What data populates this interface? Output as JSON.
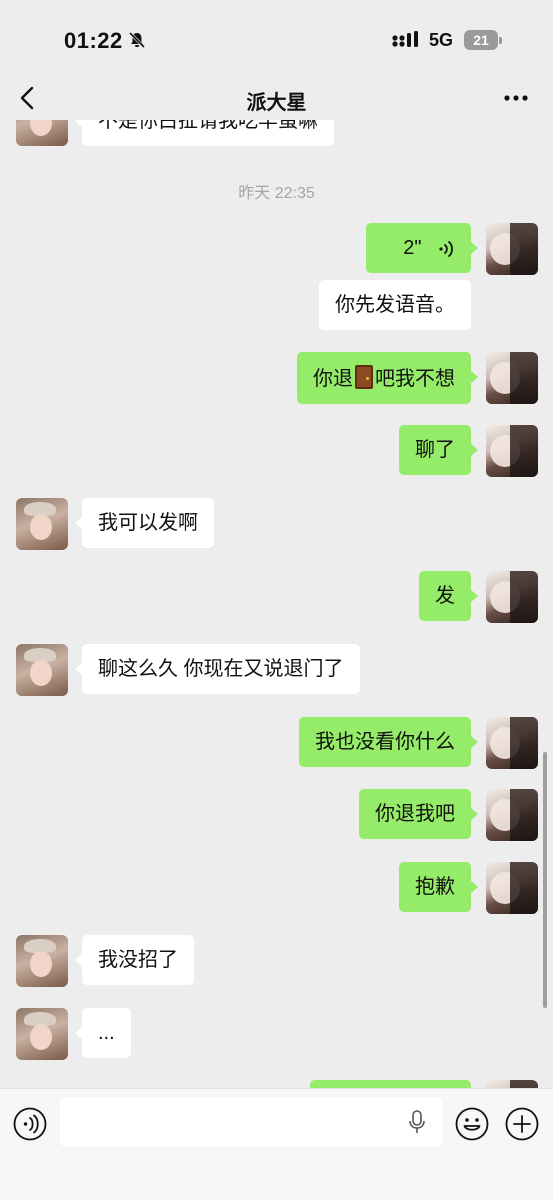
{
  "status_bar": {
    "time": "01:22",
    "network": "5G",
    "battery": "21"
  },
  "header": {
    "title": "派大星"
  },
  "chat": {
    "partial_top_text": "不是你白扯请我吃羊蛋嘛",
    "timestamp": "昨天 22:35",
    "voice_duration": "2\"",
    "messages": [
      {
        "text": "你先发语音。"
      },
      {
        "text_before": "你退",
        "text_after": "吧我不想"
      },
      {
        "text": "聊了"
      },
      {
        "text": "我可以发啊"
      },
      {
        "text": "发"
      },
      {
        "text": "聊这么久 你现在又说退门了"
      },
      {
        "text": "我也没看你什么"
      },
      {
        "text": "你退我吧"
      },
      {
        "text": "抱歉"
      },
      {
        "text": "我没招了"
      },
      {
        "text": "..."
      }
    ]
  },
  "input_bar": {
    "value": "",
    "placeholder": ""
  },
  "icons": {
    "back": "chevron-left-icon",
    "more": "more-dots-icon",
    "voice": "voice-wave-icon",
    "emoji": "emoji-icon",
    "add": "plus-icon",
    "mic": "microphone-icon"
  },
  "colors": {
    "background": "#ededed",
    "sent_bubble": "#95ec69",
    "received_bubble": "#ffffff",
    "timestamp": "#a6a6a6"
  }
}
